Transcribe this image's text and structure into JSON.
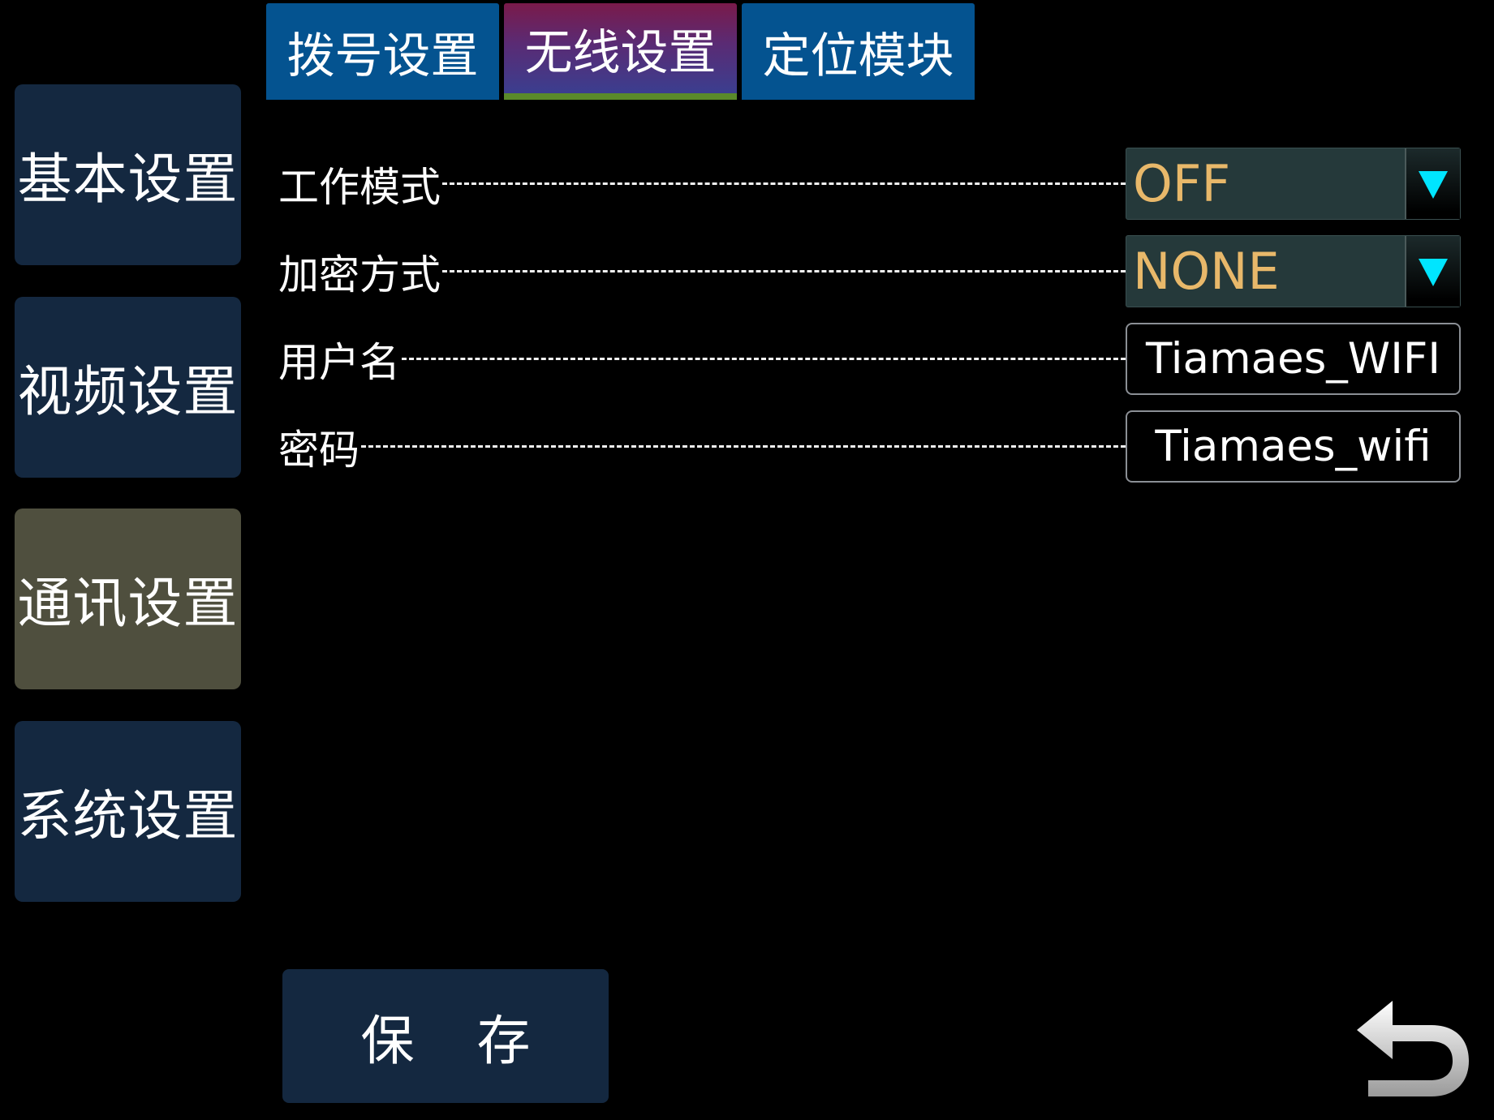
{
  "sidebar": {
    "items": [
      {
        "label": "基本设置",
        "active": false
      },
      {
        "label": "视频设置",
        "active": false
      },
      {
        "label": "通讯设置",
        "active": true
      },
      {
        "label": "系统设置",
        "active": false
      }
    ]
  },
  "tabs": [
    {
      "label": "拨号设置",
      "active": false
    },
    {
      "label": "无线设置",
      "active": true
    },
    {
      "label": "定位模块",
      "active": false
    }
  ],
  "settings": {
    "work_mode": {
      "label": "工作模式",
      "value": "OFF"
    },
    "encryption": {
      "label": "加密方式",
      "value": "NONE"
    },
    "username": {
      "label": "用户名",
      "value": "Tiamaes_WIFI"
    },
    "password": {
      "label": "密码",
      "value": "Tiamaes_wifi"
    }
  },
  "actions": {
    "save_label": "保 存",
    "back_icon": "back-arrow-icon"
  },
  "colors": {
    "background": "#000000",
    "nav_button": "#142840",
    "nav_button_active": "#4f4f3e",
    "tab": "#045390",
    "tab_active_underline": "#5a8a2a",
    "select_value_text": "#e8b86a",
    "dropdown_arrow": "#00e5ff"
  }
}
